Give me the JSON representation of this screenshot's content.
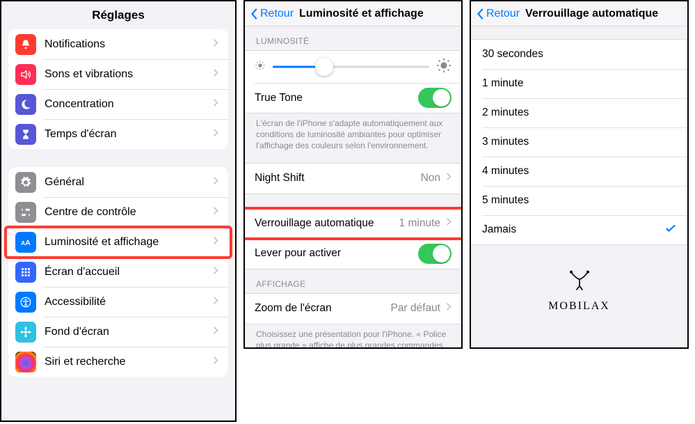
{
  "panel1": {
    "title": "Réglages",
    "group1": [
      {
        "label": "Notifications"
      },
      {
        "label": "Sons et vibrations"
      },
      {
        "label": "Concentration"
      },
      {
        "label": "Temps d'écran"
      }
    ],
    "group2": [
      {
        "label": "Général"
      },
      {
        "label": "Centre de contrôle"
      },
      {
        "label": "Luminosité et affichage"
      },
      {
        "label": "Écran d'accueil"
      },
      {
        "label": "Accessibilité"
      },
      {
        "label": "Fond d'écran"
      },
      {
        "label": "Siri et recherche"
      }
    ]
  },
  "panel2": {
    "back": "Retour",
    "title": "Luminosité et affichage",
    "section_luminosite": "LUMINOSITÉ",
    "true_tone": "True Tone",
    "note1": "L'écran de l'iPhone s'adapte automatiquement aux conditions de luminosité ambiantes pour optimiser l'affichage des couleurs selon l'environnement.",
    "night_shift": {
      "label": "Night Shift",
      "value": "Non"
    },
    "auto_lock": {
      "label": "Verrouillage automatique",
      "value": "1 minute"
    },
    "raise_wake": "Lever pour activer",
    "section_affichage": "AFFICHAGE",
    "zoom": {
      "label": "Zoom de l'écran",
      "value": "Par défaut"
    },
    "note2": "Choisissez une présentation pour l'iPhone. « Police plus grande » affiche de plus grandes commandes et « Par défaut », davantage de contenu."
  },
  "panel3": {
    "back": "Retour",
    "title": "Verrouillage automatique",
    "options": [
      "30 secondes",
      "1 minute",
      "2 minutes",
      "3 minutes",
      "4 minutes",
      "5 minutes",
      "Jamais"
    ],
    "selected_index": 6,
    "logo_text": "MOBILAX"
  }
}
